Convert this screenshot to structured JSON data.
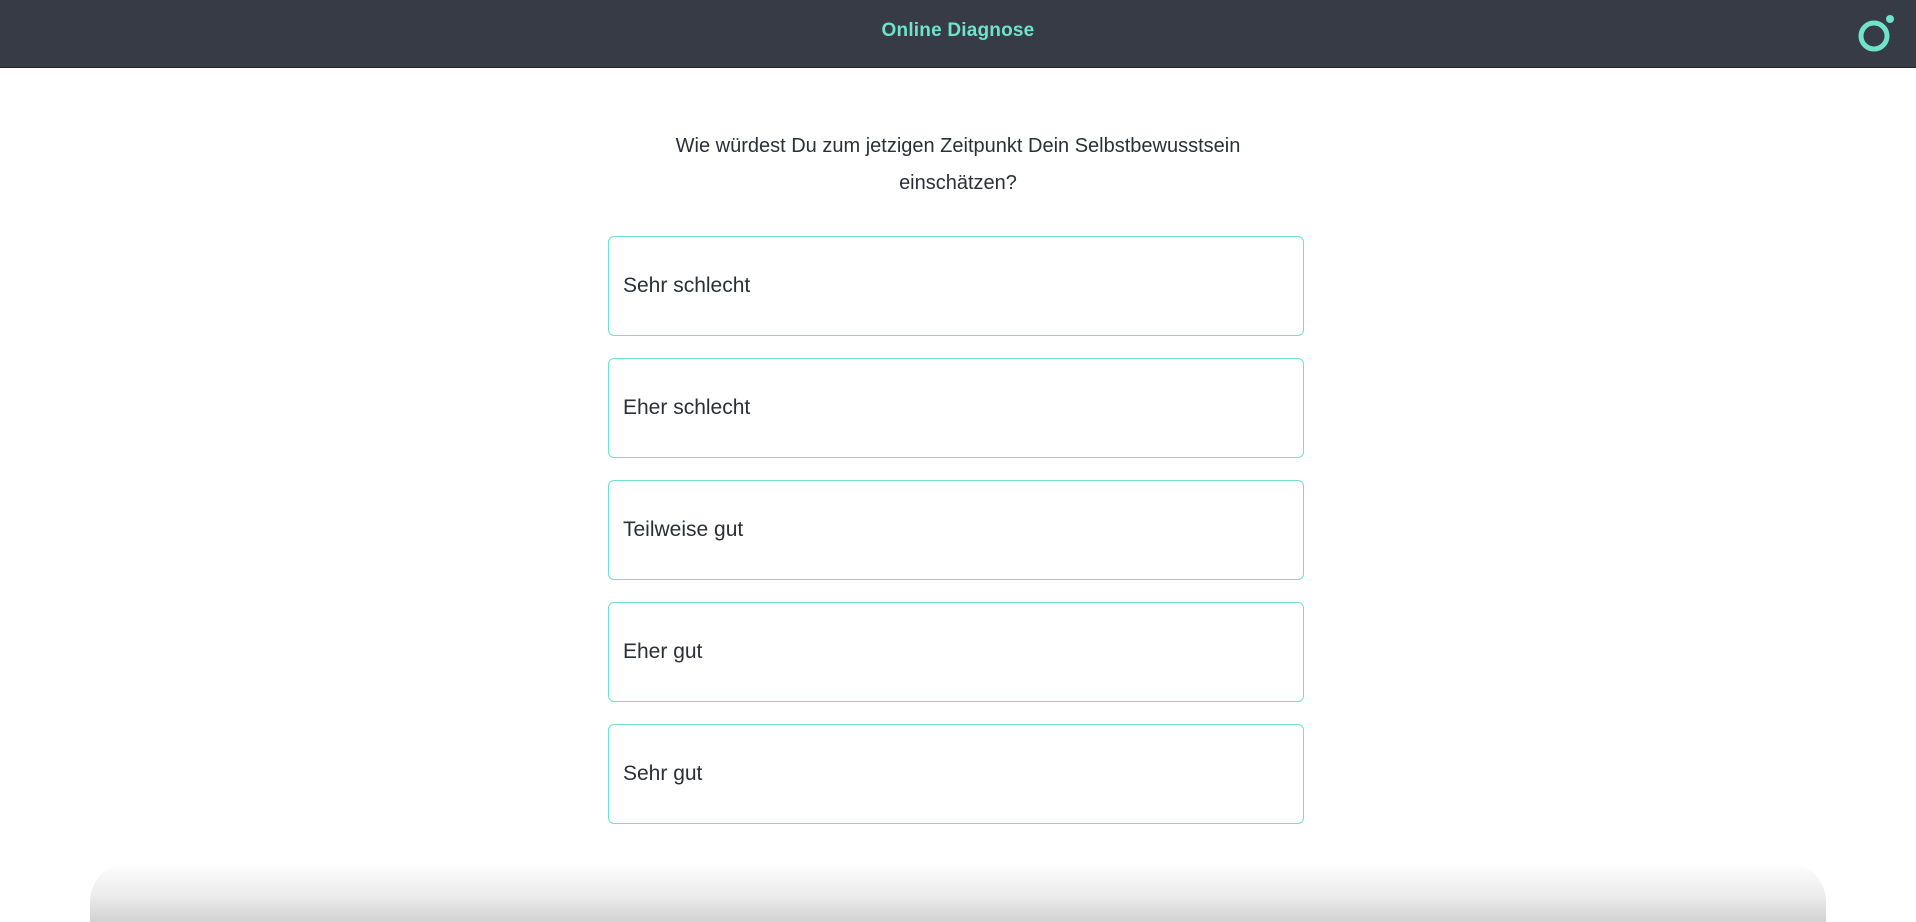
{
  "header": {
    "title": "Online Diagnose",
    "logo_icon": "ring-dot-logo-icon",
    "accent_color": "#6fe3cc",
    "background_color": "#363b45"
  },
  "question": {
    "line1": "Wie würdest Du zum jetzigen Zeitpunkt Dein Selbstbewusstsein",
    "line2": "einschätzen?"
  },
  "options": [
    {
      "label": "Sehr schlecht"
    },
    {
      "label": "Eher schlecht"
    },
    {
      "label": "Teilweise gut"
    },
    {
      "label": "Eher gut"
    },
    {
      "label": "Sehr gut"
    }
  ]
}
